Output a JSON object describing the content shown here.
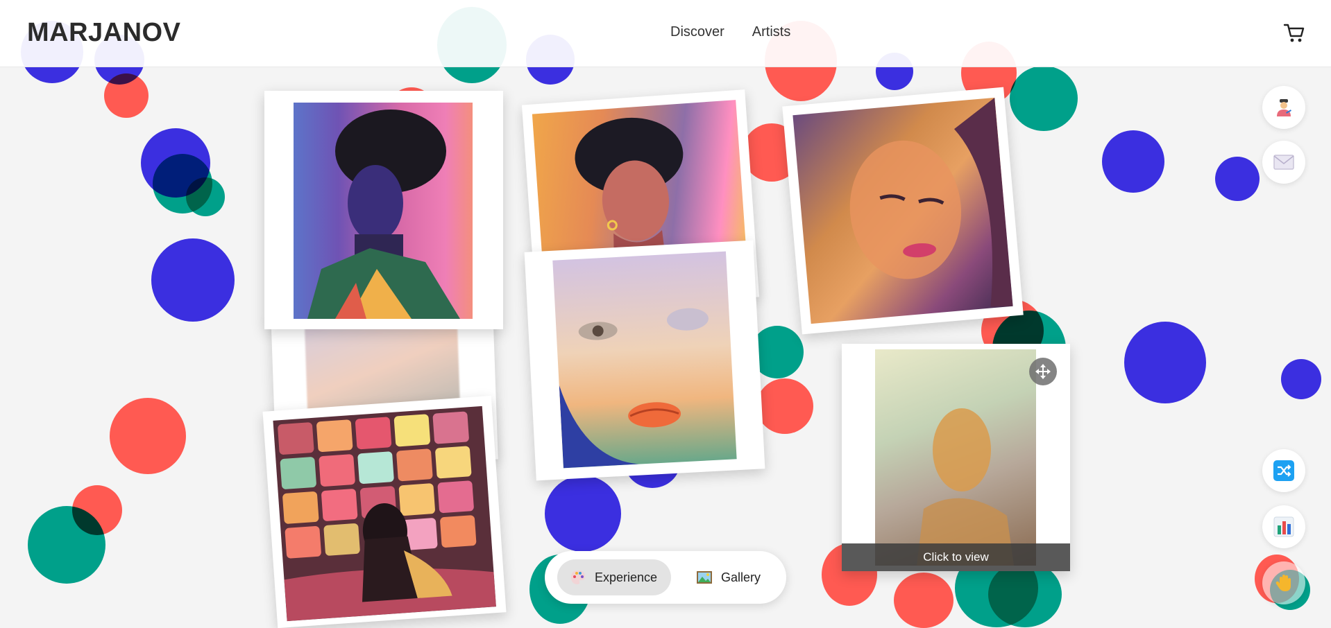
{
  "header": {
    "logo": "MARJANOV",
    "nav": [
      "Discover",
      "Artists"
    ]
  },
  "icons": {
    "cart": "cart-icon",
    "artist": "artist-icon",
    "mail": "mail-icon",
    "shuffle": "shuffle-icon",
    "stats": "bar-chart-icon",
    "hand": "hand-icon",
    "move": "move-icon",
    "palette": "palette-icon",
    "gallery": "picture-icon"
  },
  "modes": {
    "experience": "Experience",
    "gallery": "Gallery",
    "active": "Experience"
  },
  "artworks": [
    {
      "id": "portrait-blue-woman"
    },
    {
      "id": "portrait-woman-earring"
    },
    {
      "id": "portrait-woman-looking-down"
    },
    {
      "id": "blurred-figure"
    },
    {
      "id": "face-closeup"
    },
    {
      "id": "girl-with-tvs"
    },
    {
      "id": "hazy-portrait"
    }
  ],
  "preview": {
    "caption": "Click to view"
  },
  "colors": {
    "dot_blue": "#3b2fe0",
    "dot_red": "#ff5a52",
    "dot_teal": "#00a08a",
    "accent_blue": "#1da1f2"
  }
}
